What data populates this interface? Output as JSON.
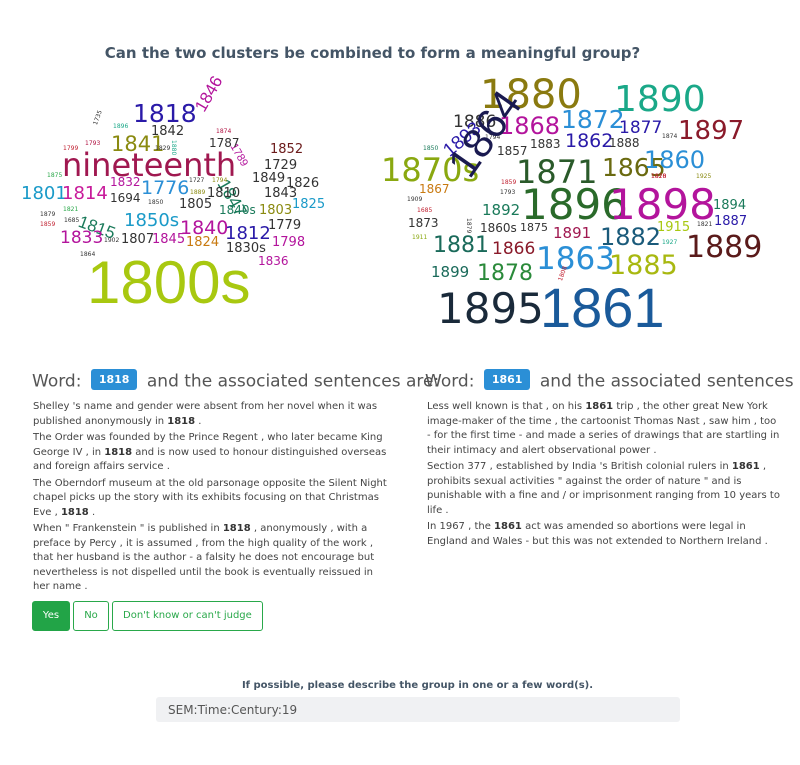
{
  "question": "Can the two clusters be combined to form a meaningful group?",
  "cloud_left": {
    "words": [
      {
        "text": "1818",
        "color": "#2a1aa8"
      },
      {
        "text": "1846",
        "color": "#b3149c"
      },
      {
        "text": "1735",
        "color": "#333333"
      },
      {
        "text": "1896",
        "color": "#1aa888"
      },
      {
        "text": "1842",
        "color": "#333333"
      },
      {
        "text": "1874",
        "color": "#b01040"
      },
      {
        "text": "1789",
        "color": "#b3149c"
      },
      {
        "text": "1852",
        "color": "#6b1a1a"
      },
      {
        "text": "1841",
        "color": "#8a8a10"
      },
      {
        "text": "1829",
        "color": "#333333"
      },
      {
        "text": "1880",
        "color": "#1aa888"
      },
      {
        "text": "1787",
        "color": "#333333"
      },
      {
        "text": "1799",
        "color": "#c02030"
      },
      {
        "text": "1793",
        "color": "#b01040"
      },
      {
        "text": "nineteenth",
        "color": "#a01850"
      },
      {
        "text": "1729",
        "color": "#333333"
      },
      {
        "text": "1847",
        "color": "#1a7a5a"
      },
      {
        "text": "1875",
        "color": "#2aa84a"
      },
      {
        "text": "1832",
        "color": "#b3149c"
      },
      {
        "text": "1776",
        "color": "#2b8fd6"
      },
      {
        "text": "1727",
        "color": "#333333"
      },
      {
        "text": "1794",
        "color": "#8a8a10"
      },
      {
        "text": "1849",
        "color": "#333333"
      },
      {
        "text": "1826",
        "color": "#333333"
      },
      {
        "text": "1801",
        "color": "#1a9ac8"
      },
      {
        "text": "1814",
        "color": "#c81a9a"
      },
      {
        "text": "1694",
        "color": "#333333"
      },
      {
        "text": "1889",
        "color": "#8a8a10"
      },
      {
        "text": "1810",
        "color": "#333333"
      },
      {
        "text": "1843",
        "color": "#333333"
      },
      {
        "text": "1850",
        "color": "#333333"
      },
      {
        "text": "1805",
        "color": "#333333"
      },
      {
        "text": "1840s",
        "color": "#1a7a5a"
      },
      {
        "text": "1803",
        "color": "#8a8a10"
      },
      {
        "text": "1825",
        "color": "#1a9ac8"
      },
      {
        "text": "1821",
        "color": "#2aa84a"
      },
      {
        "text": "1815",
        "color": "#1a7a5a"
      },
      {
        "text": "1850s",
        "color": "#1a9ac8"
      },
      {
        "text": "1879",
        "color": "#333333"
      },
      {
        "text": "1685",
        "color": "#333333"
      },
      {
        "text": "1859",
        "color": "#c02030"
      },
      {
        "text": "1840",
        "color": "#b3149c"
      },
      {
        "text": "1812",
        "color": "#2a1aa8"
      },
      {
        "text": "1779",
        "color": "#333333"
      },
      {
        "text": "1833",
        "color": "#b3149c"
      },
      {
        "text": "1902",
        "color": "#333333"
      },
      {
        "text": "1807",
        "color": "#333333"
      },
      {
        "text": "1845",
        "color": "#b3149c"
      },
      {
        "text": "1824",
        "color": "#c87a10"
      },
      {
        "text": "1830s",
        "color": "#333333"
      },
      {
        "text": "1798",
        "color": "#b3149c"
      },
      {
        "text": "1864",
        "color": "#333333"
      },
      {
        "text": "1836",
        "color": "#b3149c"
      },
      {
        "text": "1800s",
        "color": "#a8c810"
      }
    ]
  },
  "cloud_right": {
    "words": [
      {
        "text": "1880",
        "color": "#8a7a10"
      },
      {
        "text": "1890",
        "color": "#1aa888"
      },
      {
        "text": "1886",
        "color": "#333333"
      },
      {
        "text": "1868",
        "color": "#b3149c"
      },
      {
        "text": "1872",
        "color": "#2b8fd6"
      },
      {
        "text": "1877",
        "color": "#2a1aa8"
      },
      {
        "text": "1897",
        "color": "#8a1a2a"
      },
      {
        "text": "1794",
        "color": "#333333"
      },
      {
        "text": "1874",
        "color": "#333333"
      },
      {
        "text": "1883",
        "color": "#333333"
      },
      {
        "text": "1862",
        "color": "#2a1aa8"
      },
      {
        "text": "1888",
        "color": "#333333"
      },
      {
        "text": "1893",
        "color": "#2a1aa8"
      },
      {
        "text": "1857",
        "color": "#333333"
      },
      {
        "text": "1870s",
        "color": "#8aa810"
      },
      {
        "text": "1871",
        "color": "#2a5a2a"
      },
      {
        "text": "1865",
        "color": "#6a6a10"
      },
      {
        "text": "1860",
        "color": "#2b8fd6"
      },
      {
        "text": "1850",
        "color": "#1a7a5a"
      },
      {
        "text": "1870",
        "color": "#c02030"
      },
      {
        "text": "1828",
        "color": "#c02030"
      },
      {
        "text": "1925",
        "color": "#8a8a10"
      },
      {
        "text": "1867",
        "color": "#c87a10"
      },
      {
        "text": "1859",
        "color": "#c02030"
      },
      {
        "text": "1793",
        "color": "#333333"
      },
      {
        "text": "1864",
        "color": "#1a1a50"
      },
      {
        "text": "1896",
        "color": "#2a6a2a"
      },
      {
        "text": "1898",
        "color": "#b3149c"
      },
      {
        "text": "1909",
        "color": "#333333"
      },
      {
        "text": "1894",
        "color": "#1a7a5a"
      },
      {
        "text": "1685",
        "color": "#c02030"
      },
      {
        "text": "1892",
        "color": "#1a7a5a"
      },
      {
        "text": "1873",
        "color": "#333333"
      },
      {
        "text": "1879",
        "color": "#333333"
      },
      {
        "text": "1860s",
        "color": "#333333"
      },
      {
        "text": "1875",
        "color": "#333333"
      },
      {
        "text": "1891",
        "color": "#a01850"
      },
      {
        "text": "1915",
        "color": "#a8c810"
      },
      {
        "text": "1887",
        "color": "#2a1aa8"
      },
      {
        "text": "1911",
        "color": "#8aa810"
      },
      {
        "text": "1882",
        "color": "#1a5a7a"
      },
      {
        "text": "1821",
        "color": "#333333"
      },
      {
        "text": "1881",
        "color": "#1a6a5a"
      },
      {
        "text": "1866",
        "color": "#8a1a2a"
      },
      {
        "text": "1927",
        "color": "#1aa888"
      },
      {
        "text": "1889",
        "color": "#5a1a1a"
      },
      {
        "text": "1899",
        "color": "#1a6a5a"
      },
      {
        "text": "1878",
        "color": "#2a8a3a"
      },
      {
        "text": "1863",
        "color": "#2b8fd6"
      },
      {
        "text": "1885",
        "color": "#a8b810"
      },
      {
        "text": "1808",
        "color": "#c02030"
      },
      {
        "text": "1895",
        "color": "#1a2a3a"
      },
      {
        "text": "1861",
        "color": "#1a5a9a"
      }
    ]
  },
  "left_panel": {
    "heading_prefix": "Word:",
    "word": "1818",
    "heading_suffix": "and the associated sentences are:",
    "sentences": [
      {
        "before": "Shelley 's name and gender were absent from her novel when it was published anonymously in ",
        "bold": "1818",
        "after": " ."
      },
      {
        "before": "The Order was founded by the Prince Regent , who later became King George IV , in ",
        "bold": "1818",
        "after": " and is now used to honour distinguished overseas and foreign affairs service ."
      },
      {
        "before": "The Oberndorf museum at the old parsonage opposite the Silent Night chapel picks up the story with its exhibits focusing on that Christmas Eve , ",
        "bold": "1818",
        "after": " ."
      },
      {
        "before": "When \" Frankenstein \" is published in ",
        "bold": "1818",
        "after": " , anonymously , with a preface by Percy , it is assumed , from the high quality of the work , that her husband is the author - a falsity he does not encourage but nevertheless is not dispelled until the book is eventually reissued in her name ."
      }
    ]
  },
  "right_panel": {
    "heading_prefix": "Word:",
    "word": "1861",
    "heading_suffix": "and the associated sentences are:",
    "sentences": [
      {
        "before": "Less well known is that , on his ",
        "bold": "1861",
        "after": " trip , the other great New York image-maker of the time , the cartoonist Thomas Nast , saw him , too - for the first time - and made a series of drawings that are startling in their intimacy and alert observational power ."
      },
      {
        "before": "Section 377 , established by India 's British colonial rulers in ",
        "bold": "1861",
        "after": " , prohibits sexual activities \" against the order of nature \" and is punishable with a fine and / or imprisonment ranging from 10 years to life ."
      },
      {
        "before": "In 1967 , the ",
        "bold": "1861",
        "after": " act was amended so abortions were legal in England and Wales - but this was not extended to Northern Ireland ."
      }
    ]
  },
  "buttons": {
    "yes": "Yes",
    "no": "No",
    "dont_know": "Don't know or can't judge"
  },
  "describe": {
    "label": "If possible, please describe the group in one or a few word(s).",
    "value": "SEM:Time:Century:19"
  }
}
